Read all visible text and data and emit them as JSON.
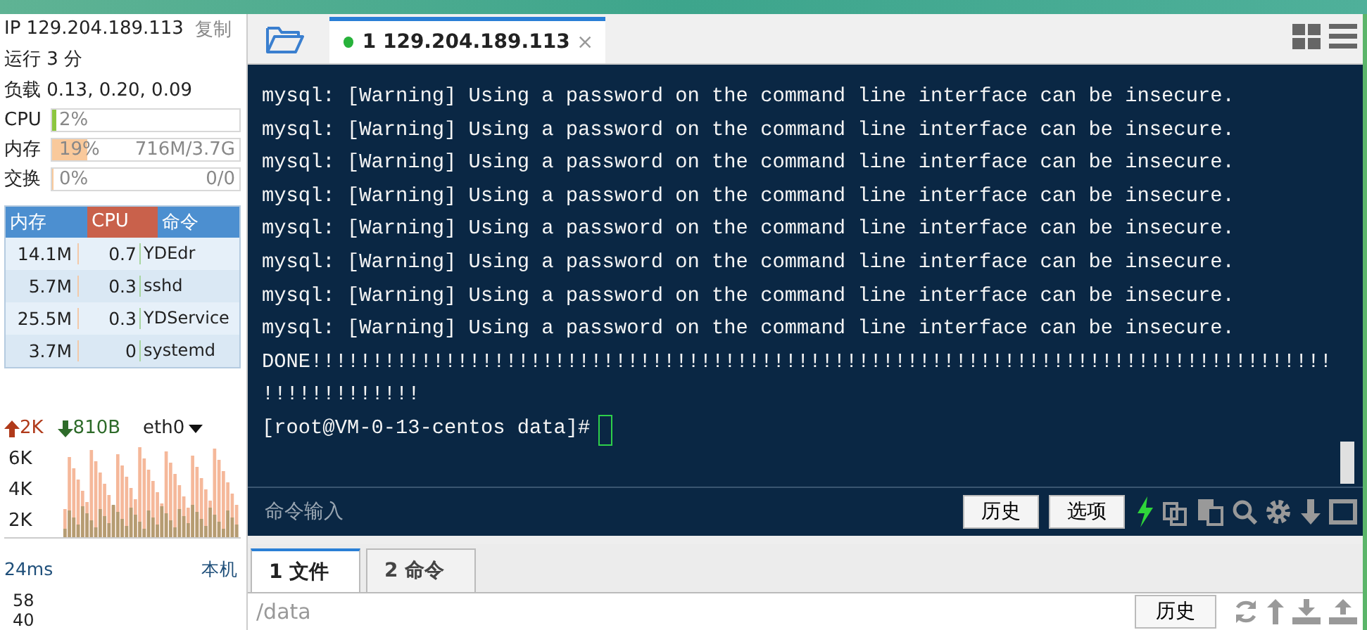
{
  "sidebar": {
    "ip": "IP 129.204.189.113",
    "copy": "复制",
    "uptime": "运行 3 分",
    "load": "负载 0.13, 0.20, 0.09",
    "meters": [
      {
        "label": "CPU",
        "text": "2%",
        "level": 0.02,
        "color": "#8cc63f"
      },
      {
        "label": "内存",
        "text": "19%",
        "extra": "716M/3.7G",
        "level": 0.19,
        "color": "#f9c99b"
      },
      {
        "label": "交换",
        "text": "0%",
        "extra": "0/0",
        "level": 0,
        "color": "#f9c99b"
      }
    ],
    "process_table": {
      "columns": [
        {
          "label": "内存",
          "selected": false
        },
        {
          "label": "CPU",
          "selected": true
        },
        {
          "label": "命令",
          "selected": false
        }
      ],
      "rows": [
        [
          "14.1M",
          "0.7",
          "YDEdr"
        ],
        [
          "5.7M",
          "0.3",
          "sshd"
        ],
        [
          "25.5M",
          "0.3",
          "YDService"
        ],
        [
          "3.7M",
          "0",
          "systemd"
        ]
      ]
    },
    "network": {
      "up": "2K",
      "down": "810B",
      "interface": "eth0",
      "yticks": [
        "6K",
        "4K",
        "2K"
      ]
    },
    "latency": {
      "value": "24ms",
      "target": "本机",
      "yticks": [
        "58",
        "40"
      ]
    }
  },
  "tabs": [
    {
      "label": "1 129.204.189.113",
      "connected": true,
      "selected": true
    }
  ],
  "terminal": {
    "lines": [
      "mysql: [Warning] Using a password on the command line interface can be insecure.",
      "mysql: [Warning] Using a password on the command line interface can be insecure.",
      "mysql: [Warning] Using a password on the command line interface can be insecure.",
      "mysql: [Warning] Using a password on the command line interface can be insecure.",
      "mysql: [Warning] Using a password on the command line interface can be insecure.",
      "mysql: [Warning] Using a password on the command line interface can be insecure.",
      "mysql: [Warning] Using a password on the command line interface can be insecure.",
      "mysql: [Warning] Using a password on the command line interface can be insecure.",
      "DONE!!!!!!!!!!!!!!!!!!!!!!!!!!!!!!!!!!!!!!!!!!!!!!!!!!!!!!!!!!!!!!!!!!!!!!!!!!!!!!!!!!!!",
      "!!!!!!!!!!!!!"
    ],
    "prompt": "[root@VM-0-13-centos data]#"
  },
  "command_bar": {
    "placeholder": "命令输入",
    "buttons": [
      "历史",
      "选项"
    ]
  },
  "bottom_tabs": [
    {
      "label": "1 文件",
      "selected": true
    },
    {
      "label": "2 命令",
      "selected": false
    }
  ],
  "file_bar": {
    "path": "/data",
    "button": "历史"
  }
}
